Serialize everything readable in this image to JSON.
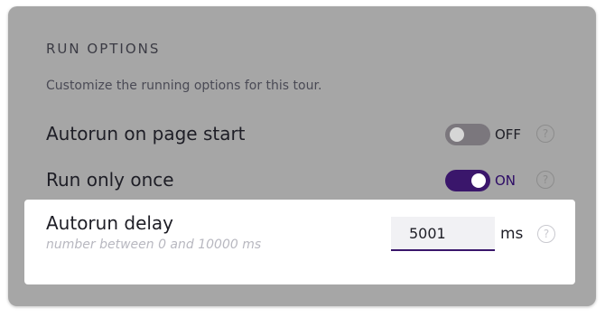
{
  "run_options": {
    "title": "RUN OPTIONS",
    "description": "Customize the running options for this tour.",
    "autorun_on_page_start": {
      "label": "Autorun on page start",
      "enabled": false,
      "state_text": "OFF",
      "help_text": "?"
    },
    "run_only_once": {
      "label": "Run only once",
      "enabled": true,
      "state_text": "ON",
      "help_text": "?"
    },
    "autorun_delay": {
      "label": "Autorun delay",
      "hint": "number between 0 and 10000 ms",
      "value": "5001",
      "unit": "ms",
      "help_text": "?"
    }
  },
  "colors": {
    "overlay": "#a6a6a6",
    "toggle_on": "#3a166b",
    "toggle_off": "#7b777d"
  }
}
